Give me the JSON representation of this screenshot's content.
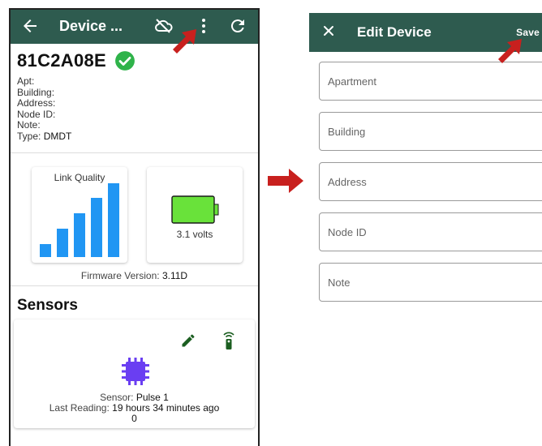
{
  "left_screen": {
    "header": {
      "title": "Device ...",
      "back_icon": "arrow-left-icon",
      "cloud_icon": "cloud-off-icon",
      "menu_icon": "more-vert-icon",
      "refresh_icon": "refresh-icon"
    },
    "device": {
      "id": "81C2A08E",
      "status_icon": "check-circle-icon",
      "status_color": "#2fb34a"
    },
    "info": [
      {
        "label": "Apt:",
        "value": ""
      },
      {
        "label": "Building:",
        "value": ""
      },
      {
        "label": "Address:",
        "value": ""
      },
      {
        "label": "Node ID:",
        "value": ""
      },
      {
        "label": "Note:",
        "value": ""
      },
      {
        "label": "Type:",
        "value": "DMDT"
      }
    ],
    "link_quality": {
      "title": "Link Quality",
      "level": 5,
      "bar_color": "#2196f3"
    },
    "battery": {
      "text": "3.1 volts",
      "fill_color": "#69e23a"
    },
    "firmware": {
      "label": "Firmware Version:",
      "value": "3.11D"
    },
    "sensors": {
      "title": "Sensors",
      "edit_icon": "pencil-icon",
      "remote_icon": "remote-icon",
      "chip_icon": "chip-icon",
      "chip_color": "#6a3ef2",
      "sensor_label": "Sensor:",
      "sensor_value": "Pulse 1",
      "last_label": "Last Reading:",
      "last_value": "19 hours 34 minutes ago",
      "reading": "0"
    }
  },
  "right_screen": {
    "header": {
      "title": "Edit Device",
      "close_icon": "close-icon",
      "save_label": "Save"
    },
    "fields": [
      {
        "placeholder": "Apartment",
        "value": ""
      },
      {
        "placeholder": "Building",
        "value": ""
      },
      {
        "placeholder": "Address",
        "value": ""
      },
      {
        "placeholder": "Node ID",
        "value": ""
      },
      {
        "placeholder": "Note",
        "value": ""
      }
    ]
  },
  "colors": {
    "header_bg": "#2e5b4f",
    "pointer_red": "#c8201e"
  }
}
